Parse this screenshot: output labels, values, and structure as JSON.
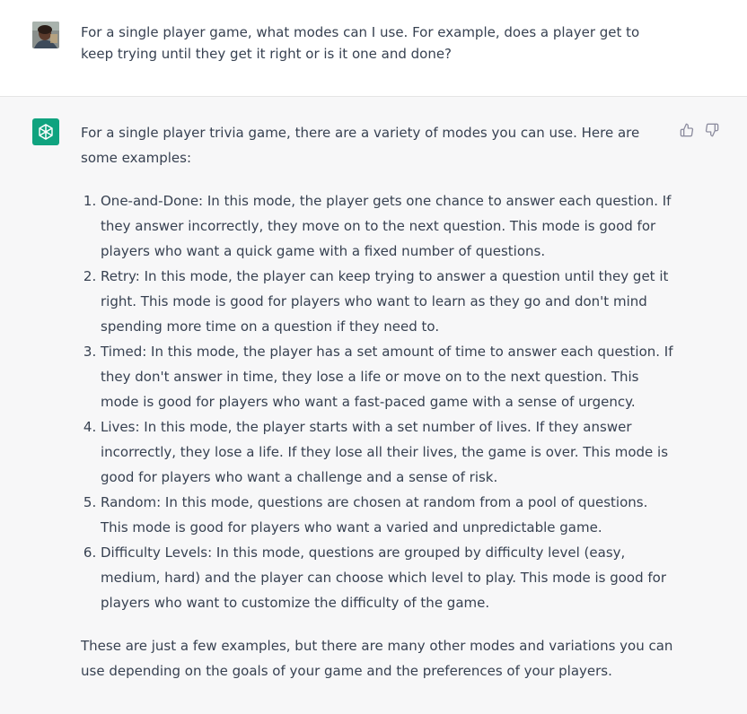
{
  "user_message": {
    "text": "For a single player game, what modes can I use.  For example, does a player get to keep trying until they get it right or is it one and done?"
  },
  "assistant_message": {
    "intro": "For a single player trivia game, there are a variety of modes you can use. Here are some examples:",
    "items": [
      "One-and-Done: In this mode, the player gets one chance to answer each question. If they answer incorrectly, they move on to the next question. This mode is good for players who want a quick game with a fixed number of questions.",
      "Retry: In this mode, the player can keep trying to answer a question until they get it right. This mode is good for players who want to learn as they go and don't mind spending more time on a question if they need to.",
      "Timed: In this mode, the player has a set amount of time to answer each question. If they don't answer in time, they lose a life or move on to the next question. This mode is good for players who want a fast-paced game with a sense of urgency.",
      "Lives: In this mode, the player starts with a set number of lives. If they answer incorrectly, they lose a life. If they lose all their lives, the game is over. This mode is good for players who want a challenge and a sense of risk.",
      "Random: In this mode, questions are chosen at random from a pool of questions. This mode is good for players who want a varied and unpredictable game.",
      "Difficulty Levels: In this mode, questions are grouped by difficulty level (easy, medium, hard) and the player can choose which level to play. This mode is good for players who want to customize the difficulty of the game."
    ],
    "outro": "These are just a few examples, but there are many other modes and variations you can use depending on the goals of your game and the preferences of your players."
  },
  "icons": {
    "user_avatar": "user-avatar-photo",
    "bot_avatar": "openai-logo-icon",
    "thumbs_up": "thumbs-up-icon",
    "thumbs_down": "thumbs-down-icon"
  },
  "colors": {
    "bot_avatar_bg": "#10a37f",
    "assistant_bg": "#f7f7f8",
    "text": "#374151"
  }
}
